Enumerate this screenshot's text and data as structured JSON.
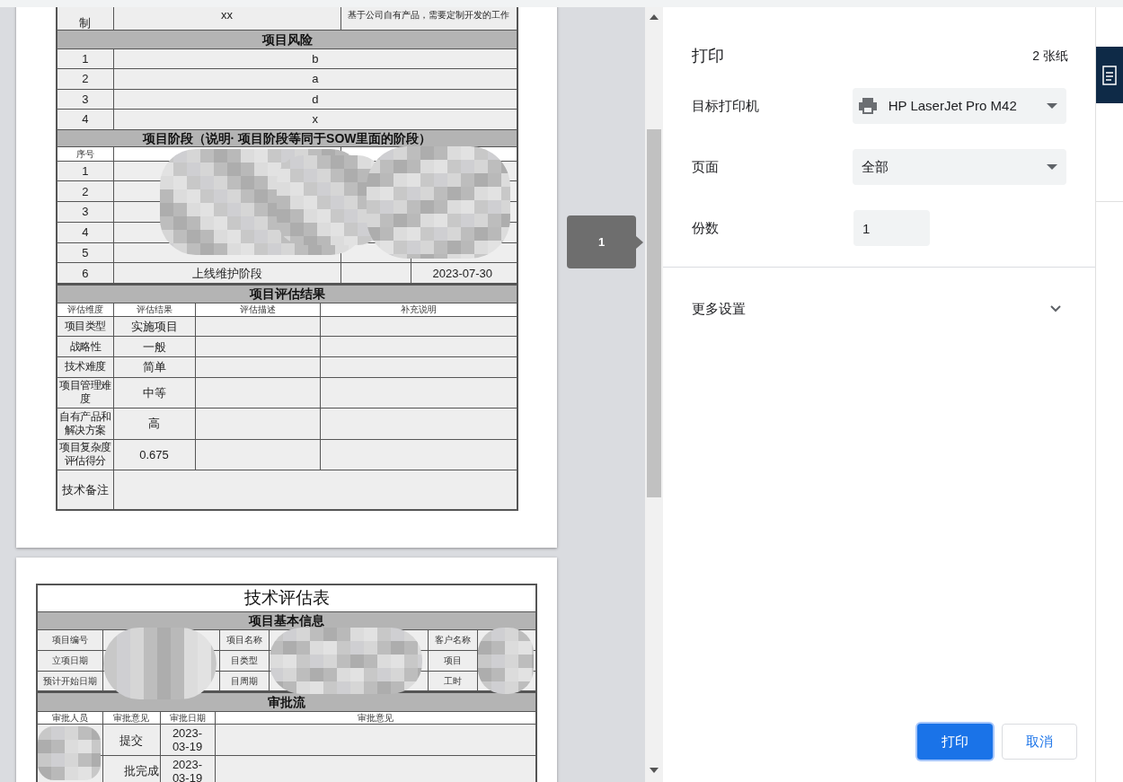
{
  "preview": {
    "page_badge": "1",
    "page_1": {
      "top_row": {
        "label": "制",
        "value": "xx",
        "note": "基于公司自有产品，需要定制开发的工作"
      },
      "risk": {
        "title": "项目风险",
        "rows": [
          {
            "no": "1",
            "text": "b"
          },
          {
            "no": "2",
            "text": "a"
          },
          {
            "no": "3",
            "text": "d"
          },
          {
            "no": "4",
            "text": "x"
          }
        ]
      },
      "stages": {
        "title": "项目阶段（说明· 项目阶段等同于SOW里面的阶段）",
        "columns": [
          "序号"
        ],
        "rows": [
          {
            "no": "1"
          },
          {
            "no": "2"
          },
          {
            "no": "3"
          },
          {
            "no": "4"
          },
          {
            "no": "5"
          },
          {
            "no": "6",
            "name": "上线维护阶段",
            "end": "2023-07-30"
          }
        ]
      },
      "evaluation": {
        "title": "项目评估结果",
        "columns": [
          "评估维度",
          "评估结果",
          "评估描述",
          "补充说明"
        ],
        "rows": [
          {
            "dimension": "项目类型",
            "result": "实施项目"
          },
          {
            "dimension": "战略性",
            "result": "一般"
          },
          {
            "dimension": "技术难度",
            "result": "简单"
          },
          {
            "dimension": "项目管理难度",
            "result": "中等"
          },
          {
            "dimension": "自有产品和解决方案",
            "result": "高"
          },
          {
            "dimension": "项目复杂度评估得分",
            "result": "0.675"
          }
        ],
        "note_label": "技术备注"
      }
    },
    "page_2": {
      "title": "技术评估表",
      "basic": {
        "title": "项目基本信息",
        "rows": [
          [
            "项目编号",
            "项目名称",
            "客户名称"
          ],
          [
            "立项日期",
            "目类型",
            "项目"
          ],
          [
            "预计开始日期",
            "目周期",
            "工时"
          ]
        ]
      },
      "approval": {
        "title": "审批流",
        "columns": [
          "审批人员",
          "审批意见",
          "审批日期",
          "审批意见"
        ],
        "rows": [
          {
            "opinion": "提交",
            "date": "2023-03-19"
          },
          {
            "opinion": "批完成",
            "date": "2023-03-19"
          }
        ]
      }
    }
  },
  "print_panel": {
    "title": "打印",
    "sheet_count": "2 张纸",
    "settings": [
      {
        "kind": "printer",
        "label": "目标打印机",
        "value": "HP LaserJet Pro M42"
      },
      {
        "kind": "select",
        "label": "页面",
        "value": "全部"
      },
      {
        "kind": "number",
        "label": "份数",
        "value": "1"
      }
    ],
    "more_settings": {
      "label": "更多设置",
      "expanded": false
    },
    "buttons": [
      {
        "label": "打印",
        "primary": true
      },
      {
        "label": "取消",
        "primary": false
      }
    ]
  }
}
